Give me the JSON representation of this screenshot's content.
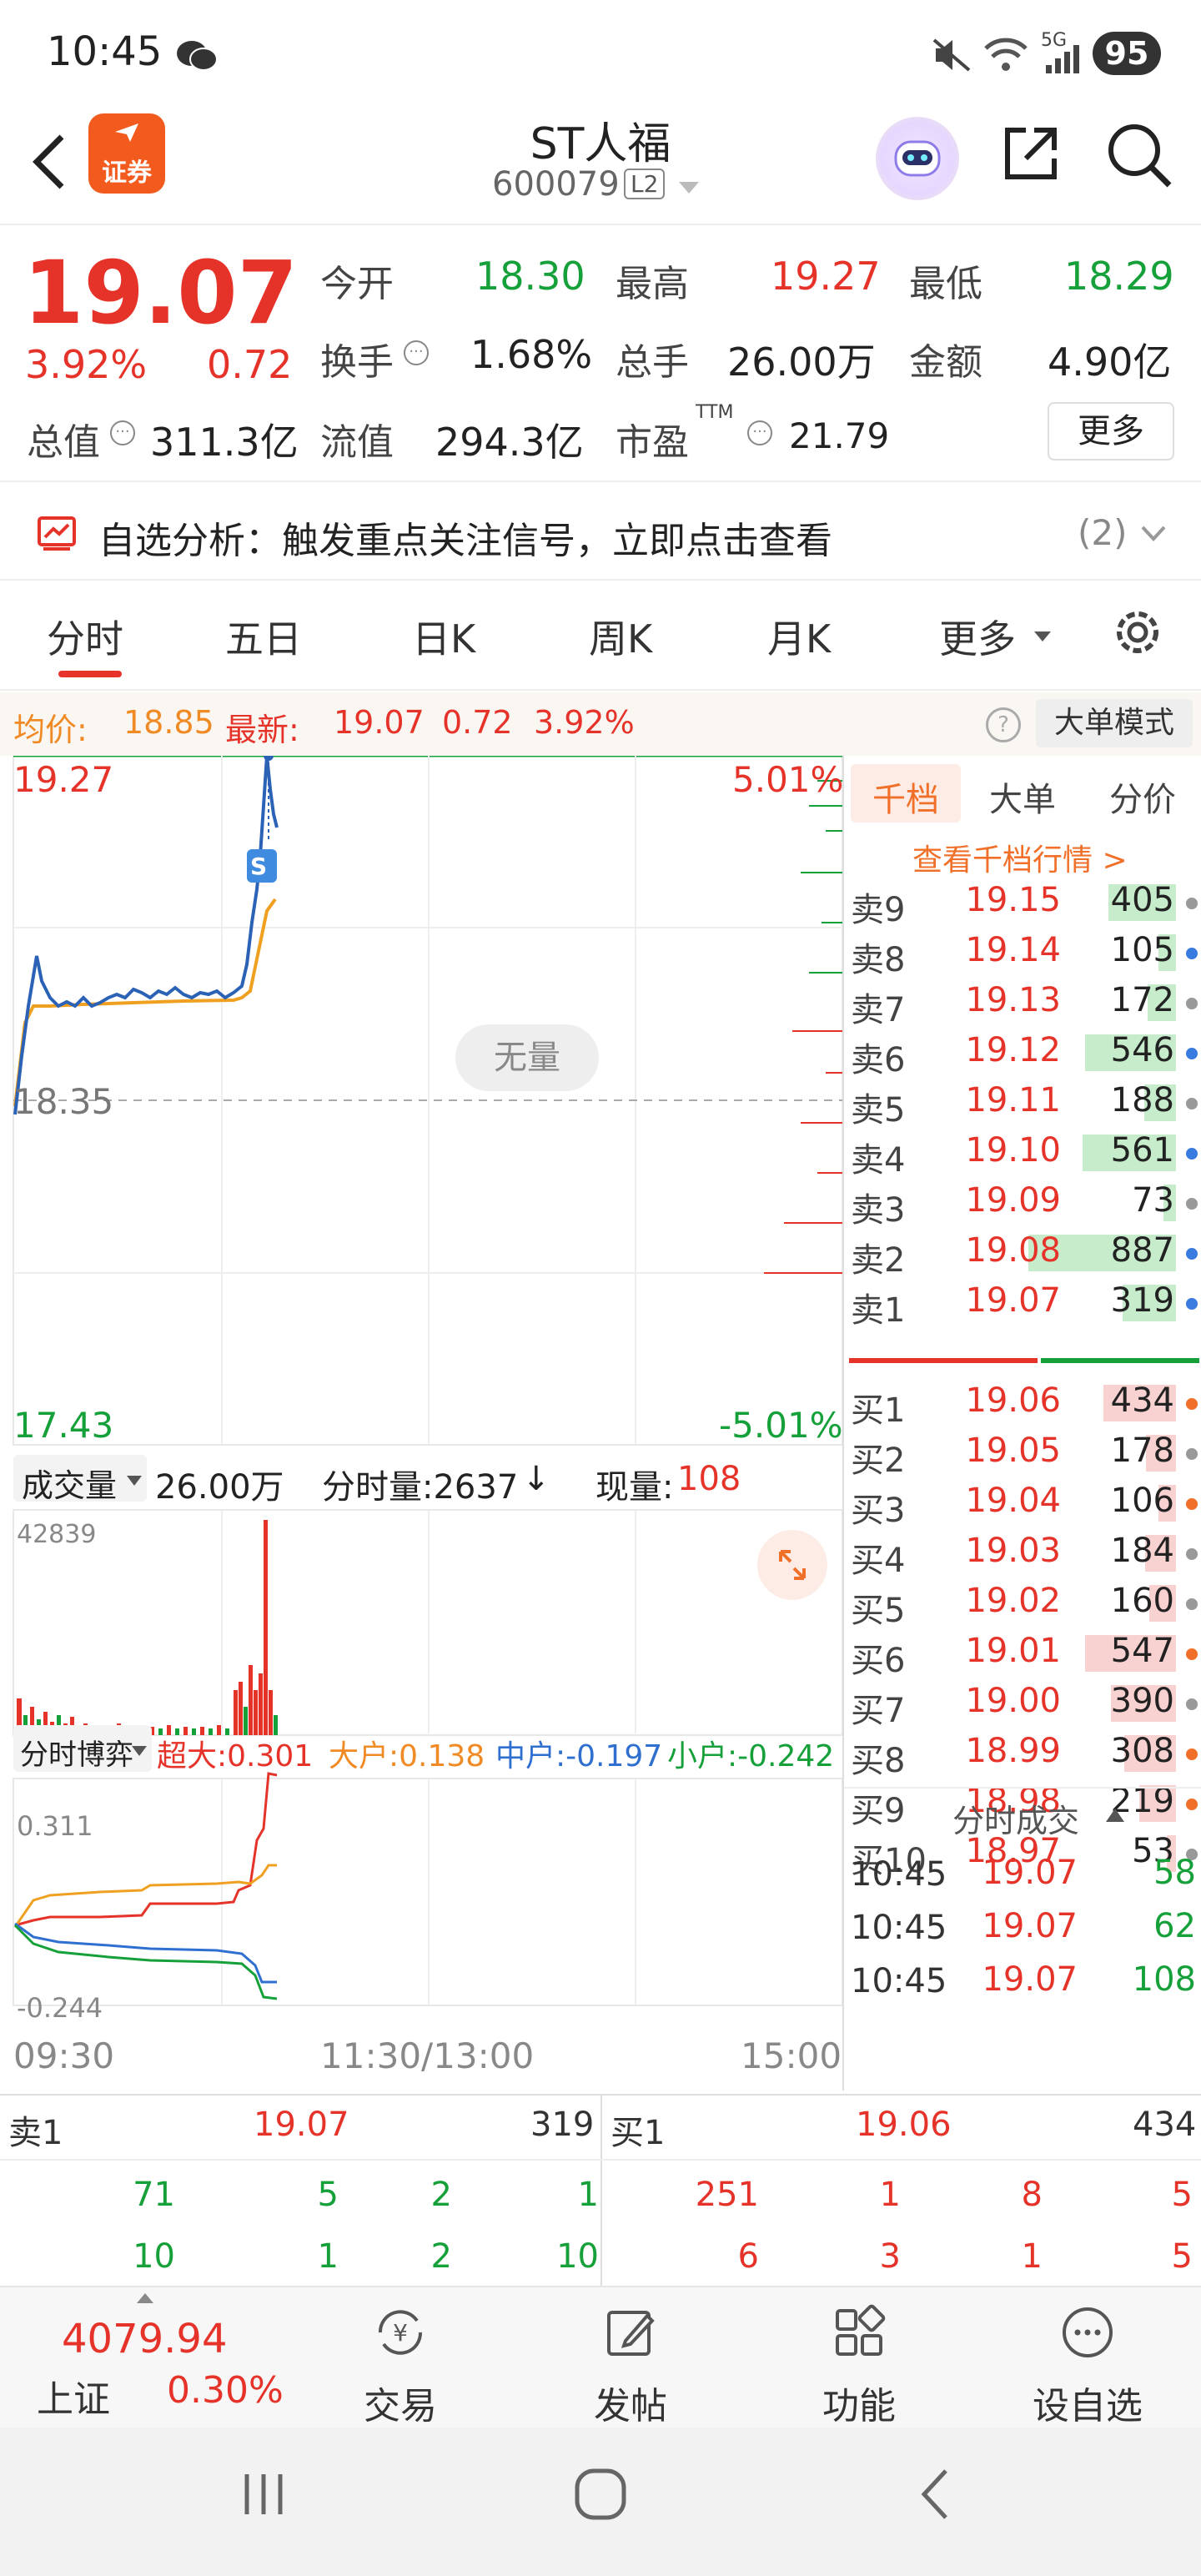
{
  "status": {
    "time": "10:45",
    "battery": "95",
    "net": "5G"
  },
  "header": {
    "title": "ST人福",
    "code": "600079",
    "level": "L2",
    "logo": "证券"
  },
  "quote": {
    "price": "19.07",
    "pct": "3.92%",
    "chg": "0.72",
    "open_label": "今开",
    "open": "18.30",
    "high_label": "最高",
    "high": "19.27",
    "low_label": "最低",
    "low": "18.29",
    "turnover_label": "换手",
    "turnover": "1.68%",
    "vol_label": "总手",
    "vol": "26.00万",
    "amount_label": "金额",
    "amount": "4.90亿",
    "mcap_label": "总值",
    "mcap": "311.3亿",
    "float_label": "流值",
    "float": "294.3亿",
    "pe_label": "市盈",
    "pe_sup": "TTM",
    "pe": "21.79",
    "more": "更多"
  },
  "alert": {
    "text": "自选分析：触发重点关注信号，立即点击查看",
    "count": "(2)"
  },
  "tabs": [
    "分时",
    "五日",
    "日K",
    "周K",
    "月K",
    "更多",
    "⚙"
  ],
  "avgbar": {
    "avg_label": "均价:",
    "avg": "18.85",
    "last_label": "最新:",
    "last": "19.07",
    "chg": "0.72",
    "pct": "3.92%",
    "mode": "大单模式"
  },
  "chart": {
    "top": "19.27",
    "top_pct": "5.01%",
    "mid": "18.35",
    "bot": "17.43",
    "bot_pct": "-5.01%",
    "noq": "无量",
    "marker": "S",
    "vol_label": "成交量",
    "vol_total": "26.00万",
    "ts_label": "分时量:2637",
    "now_label": "现量:",
    "now": "108",
    "vol_max": "42839",
    "game_label": "分时博弈",
    "super": "超大:0.301",
    "big": "大户:0.138",
    "mid_h": "中户:-0.197",
    "small": "小户:-0.242",
    "game_top": "0.311",
    "game_bot": "-0.244",
    "t_start": "09:30",
    "t_mid": "11:30/13:00",
    "t_end": "15:00"
  },
  "book": {
    "tabs": [
      "千档",
      "大单",
      "分价"
    ],
    "link": "查看千档行情 >",
    "sells": [
      {
        "l": "卖9",
        "p": "19.15",
        "v": "405"
      },
      {
        "l": "卖8",
        "p": "19.14",
        "v": "105"
      },
      {
        "l": "卖7",
        "p": "19.13",
        "v": "172"
      },
      {
        "l": "卖6",
        "p": "19.12",
        "v": "546"
      },
      {
        "l": "卖5",
        "p": "19.11",
        "v": "188"
      },
      {
        "l": "卖4",
        "p": "19.10",
        "v": "561"
      },
      {
        "l": "卖3",
        "p": "19.09",
        "v": "73"
      },
      {
        "l": "卖2",
        "p": "19.08",
        "v": "887"
      },
      {
        "l": "卖1",
        "p": "19.07",
        "v": "319"
      }
    ],
    "buys": [
      {
        "l": "买1",
        "p": "19.06",
        "v": "434"
      },
      {
        "l": "买2",
        "p": "19.05",
        "v": "178"
      },
      {
        "l": "买3",
        "p": "19.04",
        "v": "106"
      },
      {
        "l": "买4",
        "p": "19.03",
        "v": "184"
      },
      {
        "l": "买5",
        "p": "19.02",
        "v": "160"
      },
      {
        "l": "买6",
        "p": "19.01",
        "v": "547"
      },
      {
        "l": "买7",
        "p": "19.00",
        "v": "390"
      },
      {
        "l": "买8",
        "p": "18.99",
        "v": "308"
      },
      {
        "l": "买9",
        "p": "18.98",
        "v": "219"
      },
      {
        "l": "买10",
        "p": "18.97",
        "v": "53"
      }
    ],
    "trades_title": "分时成交",
    "trades": [
      {
        "t": "10:45",
        "p": "19.07",
        "v": "58"
      },
      {
        "t": "10:45",
        "p": "19.07",
        "v": "62"
      },
      {
        "t": "10:45",
        "p": "19.07",
        "v": "108"
      }
    ]
  },
  "qtable": {
    "sell_label": "卖1",
    "sell_price": "19.07",
    "sell_vol": "319",
    "buy_label": "买1",
    "buy_price": "19.06",
    "buy_vol": "434",
    "sell_rows": [
      [
        "71",
        "5",
        "2",
        "1"
      ],
      [
        "10",
        "1",
        "2",
        "10"
      ]
    ],
    "buy_rows": [
      [
        "251",
        "1",
        "8",
        "5"
      ],
      [
        "6",
        "3",
        "1",
        "5"
      ]
    ]
  },
  "bottom": {
    "index_value": "4079.94",
    "index_name": "上证",
    "index_pct": "0.30%",
    "items": [
      "交易",
      "发帖",
      "功能",
      "设自选"
    ]
  }
}
